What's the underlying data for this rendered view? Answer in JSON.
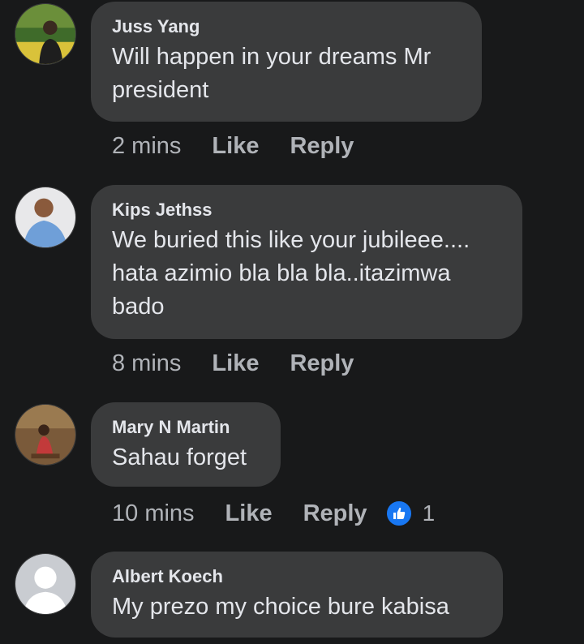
{
  "comments": [
    {
      "author": "Juss Yang",
      "text": "Will happen in your dreams Mr\npresident",
      "time": "2 mins",
      "like_label": "Like",
      "reply_label": "Reply"
    },
    {
      "author": "Kips Jethss",
      "text": "We buried this like your jubileee....\nhata azimio bla bla bla..itazimwa\nbado",
      "time": "8 mins",
      "like_label": "Like",
      "reply_label": "Reply"
    },
    {
      "author": "Mary N Martin",
      "text": "Sahau forget",
      "time": "10 mins",
      "like_label": "Like",
      "reply_label": "Reply",
      "reaction": {
        "icon": "thumbs-up-icon",
        "count": "1"
      }
    },
    {
      "author": "Albert Koech",
      "text": "My prezo my choice bure kabisa"
    }
  ],
  "colors": {
    "background": "#18191a",
    "bubble": "#3a3b3c",
    "text": "#e4e6eb",
    "secondary": "#b0b3b8",
    "like_blue": "#1877f2"
  }
}
